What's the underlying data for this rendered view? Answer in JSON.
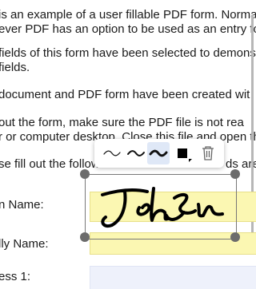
{
  "document": {
    "lines": [
      "is an example of a user fillable PDF form. Norma",
      "ever PDF has an option to be used as an entry fo",
      "fields of this form have been selected to demons",
      " fields.",
      "document and PDF form have been created wit",
      " out the form, make sure the PDF file is not rea",
      "r or computer desktop. Close this file and open th",
      "se fill out the followi"
    ],
    "line_tail": "ds are"
  },
  "form": {
    "name_label": "n Name:",
    "family_name_label": "lly Name:",
    "address_label": "ess 1:"
  },
  "toolbar": {
    "thin_stroke_icon": "thin-wave-icon",
    "medium_stroke_icon": "medium-wave-icon",
    "thick_stroke_icon": "thick-wave-icon",
    "color_icon": "color-swatch-icon",
    "delete_icon": "trash-icon",
    "selected_color": "#000000",
    "active_background": "#dfe8f7"
  },
  "colors": {
    "field_yellow": "#fbf7b2",
    "field_blue": "#eef1fb",
    "handle": "#6c6c6c"
  }
}
